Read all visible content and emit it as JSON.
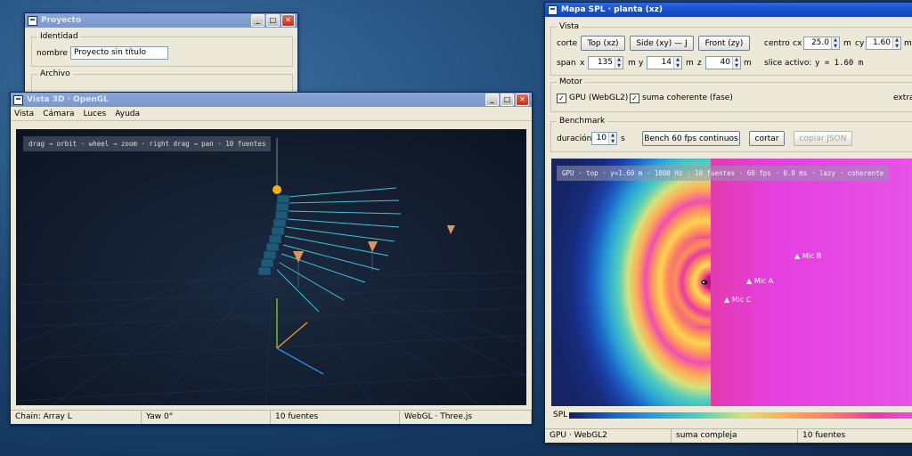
{
  "proyecto": {
    "title": "Proyecto",
    "identidad_legend": "Identidad",
    "nombre_label": "nombre",
    "nombre_value": "Proyecto sin título",
    "archivo_legend": "Archivo"
  },
  "vista3d": {
    "title": "Vista 3D · OpenGL",
    "menu": [
      "Vista",
      "Cámara",
      "Luces",
      "Ayuda"
    ],
    "hint": "drag → orbit · wheel → zoom · right drag → pan · 10 fuentes",
    "status": [
      "Chain: Array L",
      "Yaw 0°",
      "10 fuentes",
      "WebGL · Three.js"
    ]
  },
  "mapa": {
    "title": "Mapa SPL · planta (xz)",
    "vista": {
      "legend": "Vista",
      "corte_label": "corte",
      "buttons": [
        "Top (xz)",
        "Side (xy) — J",
        "Front (zy)"
      ],
      "centro_label": "centro",
      "cx_label": "cx",
      "cx_value": "25.0",
      "cx_unit": "m",
      "cy_label": "cy",
      "cy_value": "1.60",
      "cy_unit": "m",
      "span_label": "span",
      "x_label": "x",
      "x_value": "135",
      "x_unit": "m",
      "y_label": "y",
      "y_value": "14",
      "y_unit": "m",
      "z_label": "z",
      "z_value": "40",
      "z_unit": "m",
      "slice_label": "slice activo:",
      "slice_value": "y = 1.60 m"
    },
    "motor": {
      "legend": "Motor",
      "gpu_label": "GPU (WebGL2)",
      "gpu_checked": true,
      "suma_label": "suma coherente (fase)",
      "suma_checked": true,
      "extra_label": "extra:"
    },
    "benchmark": {
      "legend": "Benchmark",
      "duracion_label": "duración",
      "duracion_value": "10",
      "duracion_unit": "s",
      "bench_button": "Bench 60 fps continuos",
      "cortar_button": "cortar",
      "copiar_button": "copiar JSON"
    },
    "map_overlay": "GPU · top · y=1.60 m · 1000 Hz · 10 fuentes · 60 fps · 0.0 ms · lazy · coherente",
    "mics": [
      "Mic B",
      "Mic A",
      "Mic C"
    ],
    "spl_label": "SPL",
    "status": [
      "GPU · WebGL2",
      "suma compleja",
      "10 fuentes"
    ]
  }
}
